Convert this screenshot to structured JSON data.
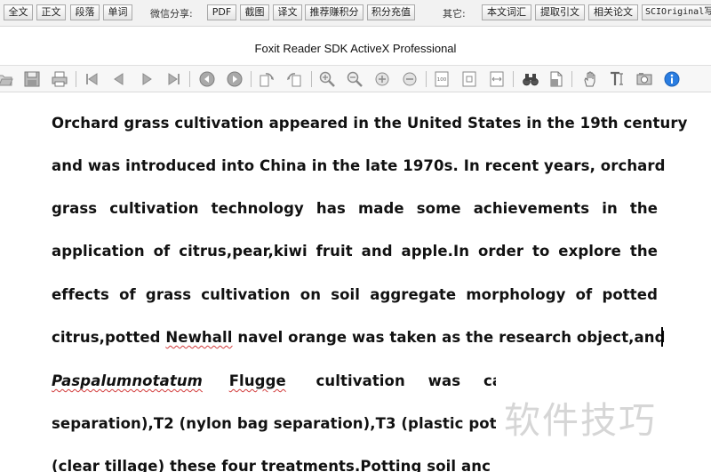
{
  "topbar": {
    "buttons_left": [
      "全文",
      "正文",
      "段落",
      "单词"
    ],
    "share_label": "微信分享:",
    "buttons_share": [
      "PDF",
      "截图",
      "译文",
      "推荐赚积分",
      "积分充值"
    ],
    "other_label": "其它:",
    "buttons_other": [
      "本文词汇",
      "提取引文",
      "相关论文",
      "SCIOriginal写"
    ]
  },
  "window": {
    "title": "Foxit Reader SDK ActiveX Professional"
  },
  "toolbar": {
    "icons": [
      "open-icon",
      "save-icon",
      "print-icon",
      "first-page-icon",
      "previous-page-icon",
      "next-page-icon",
      "last-page-icon",
      "go-back-icon",
      "go-forward-icon",
      "rotate-left-icon",
      "rotate-right-icon",
      "zoom-in-icon",
      "zoom-out-icon",
      "zoom-in-plus-icon",
      "zoom-out-minus-icon",
      "actual-size-icon",
      "fit-page-icon",
      "fit-width-icon",
      "find-icon",
      "document-properties-icon",
      "hand-tool-icon",
      "text-select-icon",
      "snapshot-icon",
      "about-icon"
    ]
  },
  "document": {
    "lines": [
      {
        "text": "Orchard grass cultivation appeared in the United States in the 19th century"
      },
      {
        "text": "and was introduced into China in the late 1970s. In recent years, orchard"
      },
      {
        "text": "grass cultivation technology has made some achievements in the"
      },
      {
        "text": "application of citrus,pear,kiwi fruit and apple.In order to explore the"
      },
      {
        "text": "effects of grass cultivation on soil aggregate morphology of potted"
      },
      {
        "text_a": "citrus,potted ",
        "text_b": "Newhall",
        "text_c": " navel orange was taken as the research object,and"
      },
      {
        "text_a": "Paspalumnotatum",
        "text_b": "Flugge",
        "text_c": "cultivation was carriec"
      },
      {
        "text": "separation),T2 (nylon bag separation),T3 (plastic pot"
      },
      {
        "text": "(clear tillage) these four treatments.Potting soil anc"
      }
    ]
  },
  "watermark": "软件技巧"
}
